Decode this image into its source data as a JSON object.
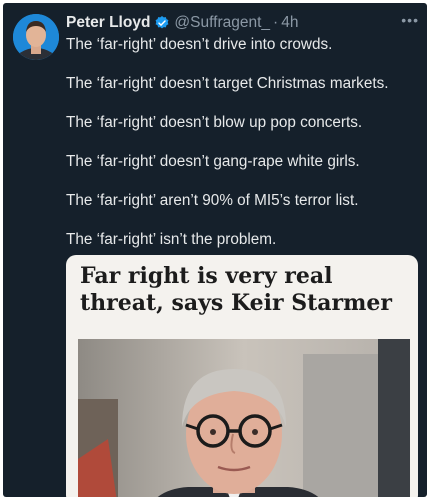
{
  "tweet": {
    "author_name": "Peter Lloyd",
    "handle": "@Suffragent_",
    "separator": "·",
    "time": "4h",
    "more_icon": "more-horizontal-icon",
    "lines": [
      "The ‘far-right’ doesn’t drive into crowds.",
      "The ‘far-right’ doesn’t target Christmas markets.",
      "The ‘far-right’ doesn’t blow up pop concerts.",
      "The ‘far-right’ doesn’t gang-rape white girls.",
      "The ‘far-right’ aren’t 90% of MI5’s terror list.",
      "The ‘far-right’ isn’t the problem."
    ]
  },
  "card": {
    "headline": "Far right is very real threat, says Keir Starmer"
  },
  "colors": {
    "background": "#15202b",
    "text": "#e7e9ea",
    "muted": "#8b98a5",
    "verified": "#1d9bf0"
  }
}
